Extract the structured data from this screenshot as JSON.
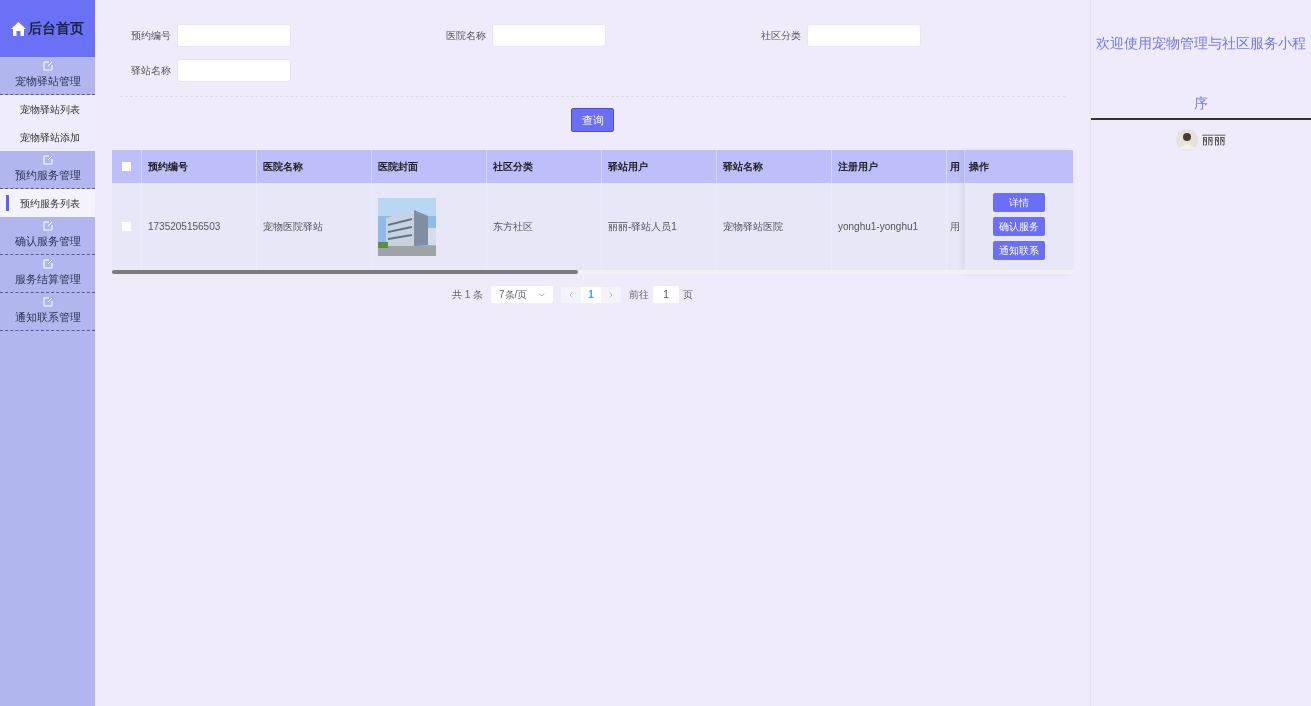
{
  "sidebar": {
    "home": "后台首页",
    "menus": [
      {
        "label": "宠物驿站管理",
        "children": [
          {
            "label": "宠物驿站列表",
            "selected": false
          },
          {
            "label": "宠物驿站添加",
            "selected": false
          }
        ]
      },
      {
        "label": "预约服务管理",
        "children": [
          {
            "label": "预约服务列表",
            "selected": true
          }
        ]
      },
      {
        "label": "确认服务管理"
      },
      {
        "label": "服务结算管理"
      },
      {
        "label": "通知联系管理"
      }
    ]
  },
  "search": {
    "fields": [
      {
        "label": "预约编号"
      },
      {
        "label": "医院名称"
      },
      {
        "label": "社区分类"
      },
      {
        "label": "驿站名称"
      }
    ],
    "button": "查询"
  },
  "table": {
    "select_all_checked": false,
    "columns": [
      "预约编号",
      "医院名称",
      "医院封面",
      "社区分类",
      "驿站用户",
      "驿站名称",
      "注册用户",
      "用"
    ],
    "action_column": "操作",
    "rows": [
      {
        "checked": false,
        "cells": [
          "1735205156503",
          "宠物医院驿站",
          {
            "kind": "picture"
          },
          "东方社区",
          "丽丽-驿站人员1",
          "宠物驿站医院",
          "yonghu1-yonghu1",
          "用"
        ],
        "actions": [
          "详情",
          "确认服务",
          "通知联系"
        ]
      }
    ]
  },
  "pagination": {
    "total": "共 1 条",
    "page_size": "7条/页",
    "pages": [
      {
        "label": "1",
        "selected": true
      }
    ],
    "goto_label": "前往",
    "goto_value": "1",
    "page_unit": "页"
  },
  "welcome": {
    "title": "欢迎使用宠物管理与社区服务小程序",
    "user": "丽丽"
  }
}
